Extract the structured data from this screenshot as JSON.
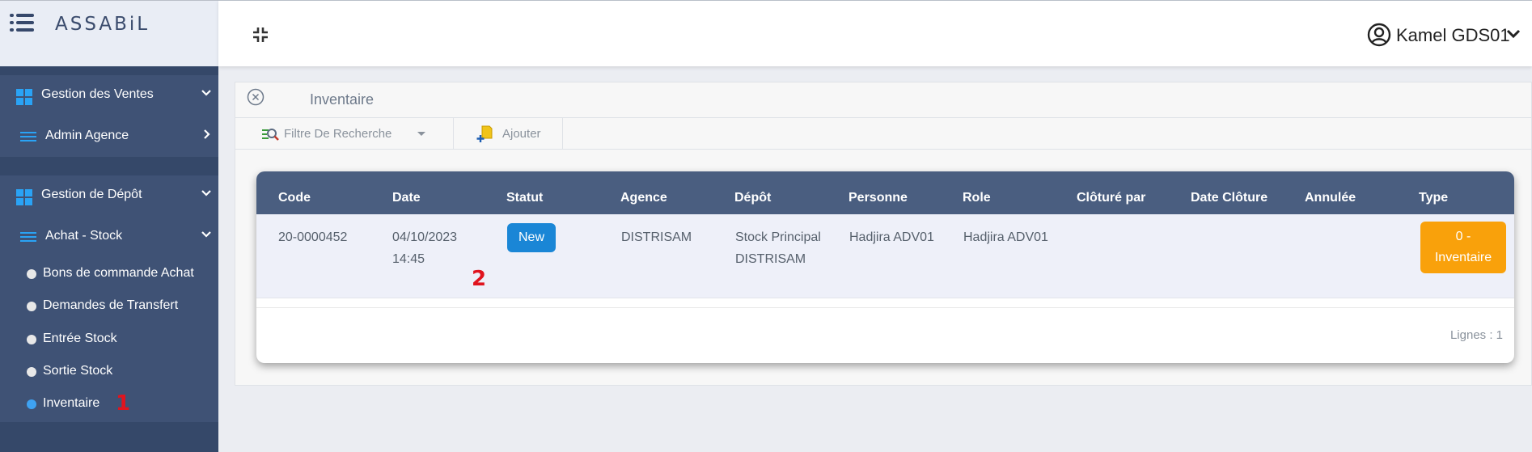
{
  "brand": {
    "logo_text": "ASSABiL"
  },
  "header": {
    "user_name": "Kamel GDS01"
  },
  "sidebar": {
    "group1": [
      {
        "label": "Gestion des Ventes"
      },
      {
        "label": "Admin Agence"
      }
    ],
    "group2": {
      "section": {
        "label": "Gestion de Dépôt"
      },
      "submenu": {
        "label": "Achat - Stock"
      },
      "items": [
        {
          "label": "Bons de commande Achat"
        },
        {
          "label": "Demandes de Transfert"
        },
        {
          "label": "Entrée Stock"
        },
        {
          "label": "Sortie Stock"
        },
        {
          "label": "Inventaire"
        }
      ]
    }
  },
  "annotations": {
    "marker1": "1",
    "marker2": "2"
  },
  "panel": {
    "title": "Inventaire",
    "toolbar": {
      "filter_label": "Filtre De Recherche",
      "add_label": "Ajouter"
    }
  },
  "table": {
    "columns": [
      "Code",
      "Date",
      "Statut",
      "Agence",
      "Dépôt",
      "Personne",
      "Role",
      "Clôturé par",
      "Date Clôture",
      "Annulée",
      "Type"
    ],
    "rows": [
      {
        "code": "20-0000452",
        "date_line1": "04/10/2023",
        "date_line2": "14:45",
        "statut": "New",
        "agence": "DISTRISAM",
        "depot_line1": "Stock Principal",
        "depot_line2": "DISTRISAM",
        "personne": "Hadjira ADV01",
        "role": "Hadjira ADV01",
        "cloture_par": "",
        "date_cloture": "",
        "annulee": "",
        "type_line1": "0 -",
        "type_line2": "Inventaire"
      }
    ],
    "row_count": "Lignes : 1"
  },
  "colors": {
    "sidebar": "#354869",
    "sidebar_group": "#3f5275",
    "table_header": "#4a5e80",
    "status_new": "#1a86d6",
    "type_badge": "#f9a10b",
    "active_dot": "#3ea2f2",
    "marker": "#e0141e"
  }
}
